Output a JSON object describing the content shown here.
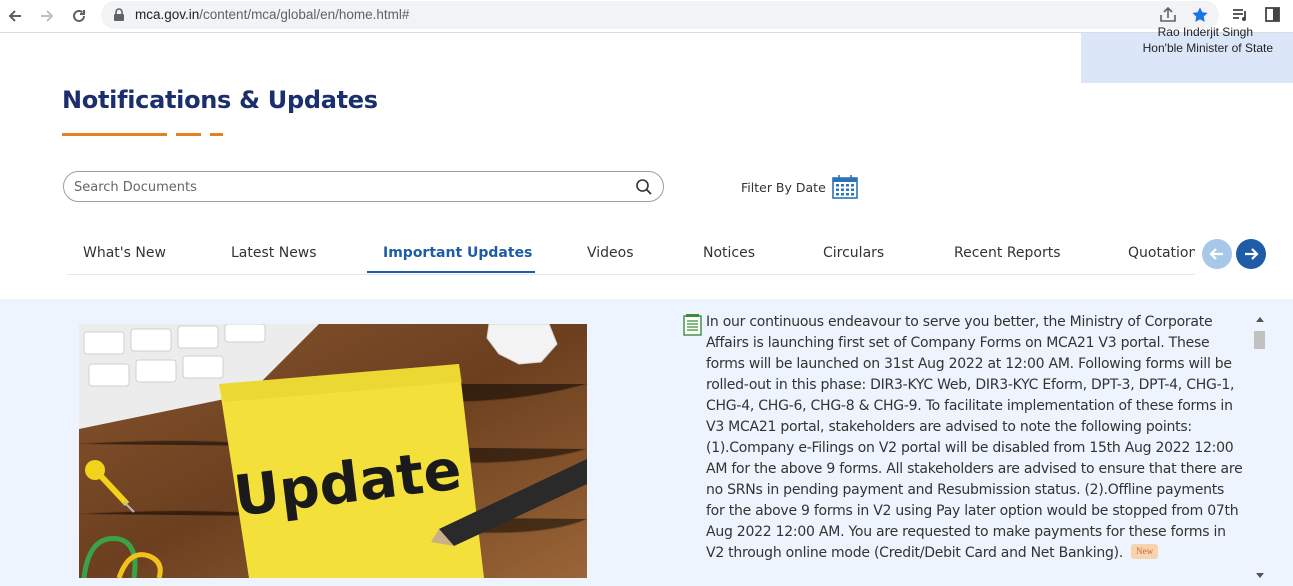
{
  "browser": {
    "url_host": "mca.gov.in",
    "url_path": "/content/mca/global/en/home.html#"
  },
  "minister": {
    "name": "Rao Inderjit Singh",
    "role": "Hon'ble Minister of State"
  },
  "section": {
    "title": "Notifications & Updates"
  },
  "search": {
    "placeholder": "Search Documents",
    "value": ""
  },
  "filter": {
    "label": "Filter By Date"
  },
  "tabs": [
    {
      "label": "What's New"
    },
    {
      "label": "Latest News"
    },
    {
      "label": "Important Updates",
      "active": true
    },
    {
      "label": "Videos"
    },
    {
      "label": "Notices"
    },
    {
      "label": "Circulars"
    },
    {
      "label": "Recent Reports"
    },
    {
      "label": "Quotations"
    }
  ],
  "image": {
    "note_text": "Update"
  },
  "notice": {
    "text": "In our continuous endeavour to serve you better, the Ministry of Corporate Affairs is launching first set of Company Forms on MCA21 V3 portal. These forms will be launched on 31st Aug 2022 at 12:00 AM. Following forms will be rolled-out in this phase: DIR3-KYC Web, DIR3-KYC Eform, DPT-3, DPT-4, CHG-1, CHG-4, CHG-6, CHG-8 & CHG-9. To facilitate implementation of these forms in V3 MCA21 portal, stakeholders are advised to note the following points: (1).Company e-Filings on V2 portal will be disabled from 15th Aug 2022 12:00 AM for the above 9 forms. All stakeholders are advised to ensure that there are no SRNs in pending payment and Resubmission status. (2).Offline payments for the above 9 forms in V2 using Pay later option would be stopped from 07th Aug 2022 12:00 AM. You are requested to make payments for these forms in V2 through online mode (Credit/Debit Card and Net Banking).",
    "badge": "New"
  },
  "colors": {
    "title": "#1b2f6e",
    "accent_orange": "#e67e22",
    "active_tab": "#1f5ca8",
    "panel_bg": "#edf4fd"
  }
}
